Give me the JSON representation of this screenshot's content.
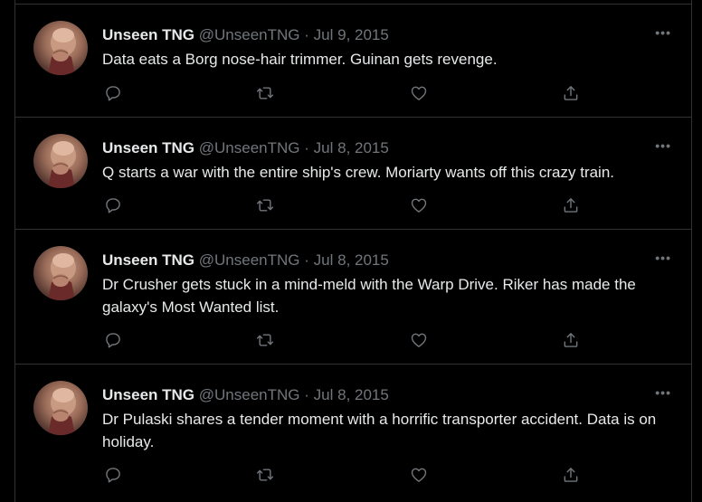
{
  "tweets": [
    {
      "display_name": "Unseen TNG",
      "handle": "@UnseenTNG",
      "separator": "·",
      "date": "Jul 9, 2015",
      "text": "Data eats a Borg nose-hair trimmer. Guinan gets revenge.",
      "more": "•••",
      "icons": [
        "reply-icon",
        "retweet-icon",
        "like-icon",
        "share-icon"
      ]
    },
    {
      "display_name": "Unseen TNG",
      "handle": "@UnseenTNG",
      "separator": "·",
      "date": "Jul 8, 2015",
      "text": "Q starts a war with the entire ship's crew. Moriarty wants off this crazy train.",
      "more": "•••",
      "icons": [
        "reply-icon",
        "retweet-icon",
        "like-icon",
        "share-icon"
      ]
    },
    {
      "display_name": "Unseen TNG",
      "handle": "@UnseenTNG",
      "separator": "·",
      "date": "Jul 8, 2015",
      "text": "Dr Crusher gets stuck in a mind-meld with the Warp Drive. Riker has made the galaxy's Most Wanted list.",
      "more": "•••",
      "icons": [
        "reply-icon",
        "retweet-icon",
        "like-icon",
        "share-icon"
      ]
    },
    {
      "display_name": "Unseen TNG",
      "handle": "@UnseenTNG",
      "separator": "·",
      "date": "Jul 8, 2015",
      "text": "Dr Pulaski shares a tender moment with a horrific transporter accident. Data is on holiday.",
      "more": "•••",
      "icons": [
        "reply-icon",
        "retweet-icon",
        "like-icon",
        "share-icon"
      ]
    }
  ],
  "colors": {
    "background": "#000000",
    "primary_text": "#e7e9ea",
    "secondary_text": "#71767b",
    "border": "#2f3336"
  }
}
